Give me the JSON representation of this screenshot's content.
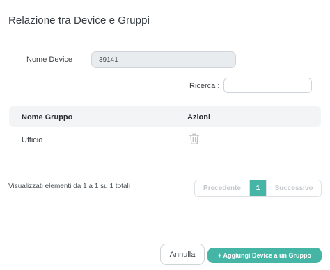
{
  "modal": {
    "title": "Relazione tra Device e Gruppi"
  },
  "form": {
    "device_label": "Nome Device",
    "device_value": "39141"
  },
  "search": {
    "label": "Ricerca :",
    "value": ""
  },
  "table": {
    "headers": {
      "name": "Nome Gruppo",
      "actions": "Azioni"
    },
    "rows": [
      {
        "name": "Ufficio",
        "action_icon": "trash-icon"
      }
    ]
  },
  "pagination": {
    "info": "Visualizzati elementi da 1 a 1 su 1 totali",
    "prev_label": "Precedente",
    "current_page": "1",
    "next_label": "Successivo"
  },
  "footer": {
    "cancel_label": "Annulla",
    "add_label": "+ Aggiungi Device a un Gruppo"
  },
  "colors": {
    "accent": "#45b5a5",
    "readonly_input_bg": "#e9ecef",
    "table_header_bg": "#f3f4f6"
  }
}
